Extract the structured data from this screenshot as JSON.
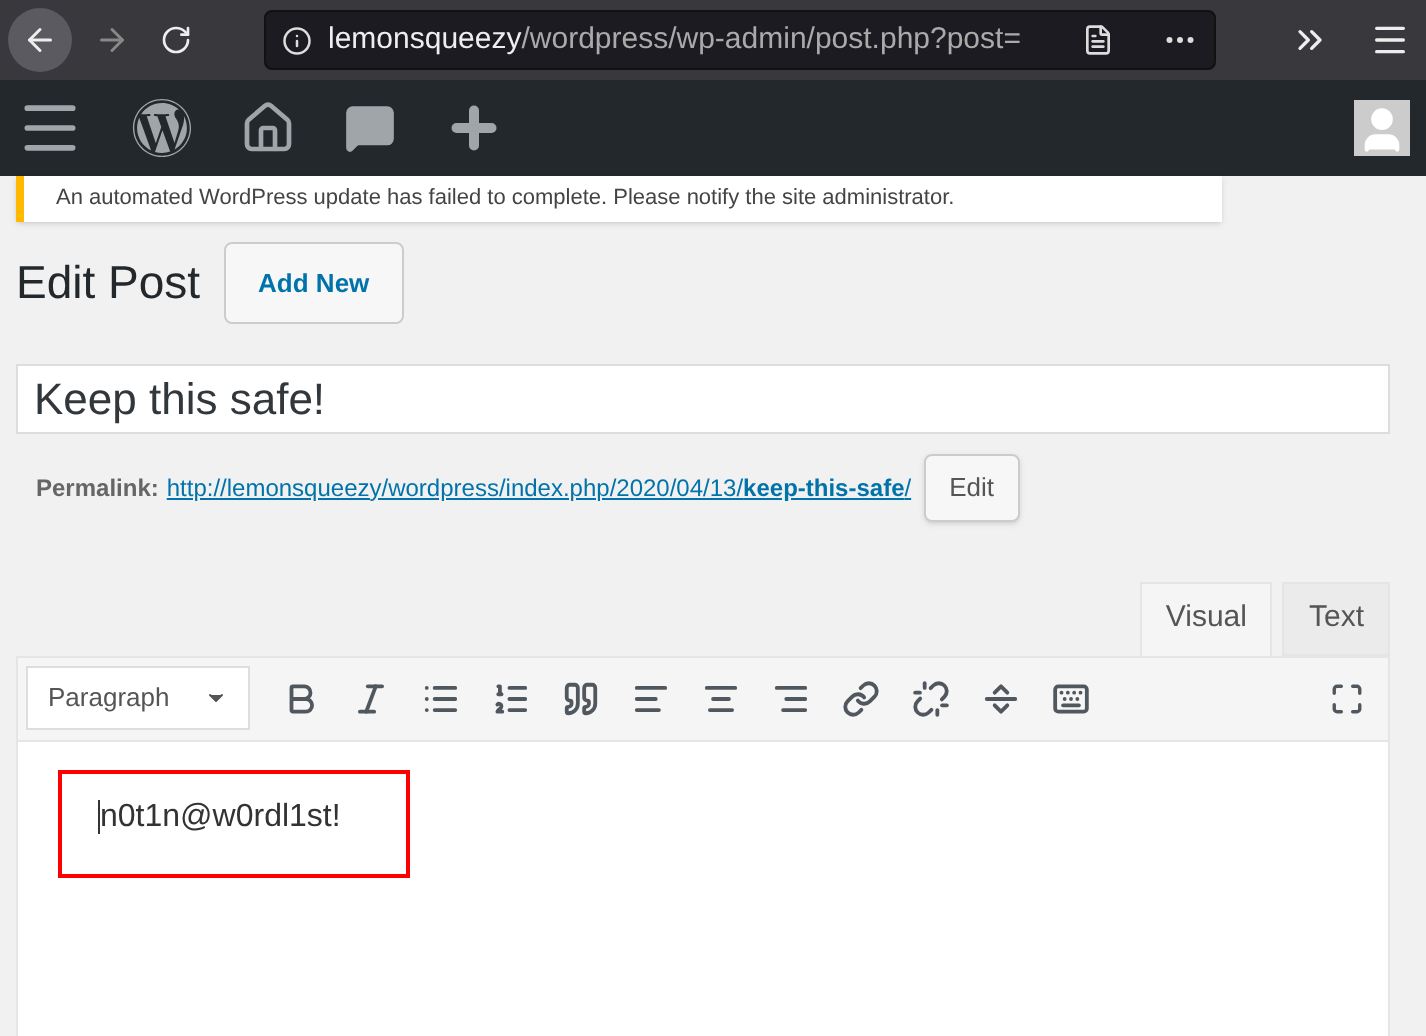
{
  "browser": {
    "url_host": "lemonsqueezy",
    "url_path": "/wordpress/wp-admin/post.php?post="
  },
  "notice": "An automated WordPress update has failed to complete. Please notify the site administrator.",
  "heading": "Edit Post",
  "add_new": "Add New",
  "title_value": "Keep this safe!",
  "permalink": {
    "label": "Permalink:",
    "url_base": "http://lemonsqueezy/wordpress/index.php/2020/04/13/",
    "slug": "keep-this-safe",
    "url_end": "/",
    "edit": "Edit"
  },
  "tabs": [
    {
      "label": "Visual",
      "selected": true
    },
    {
      "label": "Text",
      "selected": false
    }
  ],
  "format_select": "Paragraph",
  "content": "n0t1n@w0rdl1st!"
}
